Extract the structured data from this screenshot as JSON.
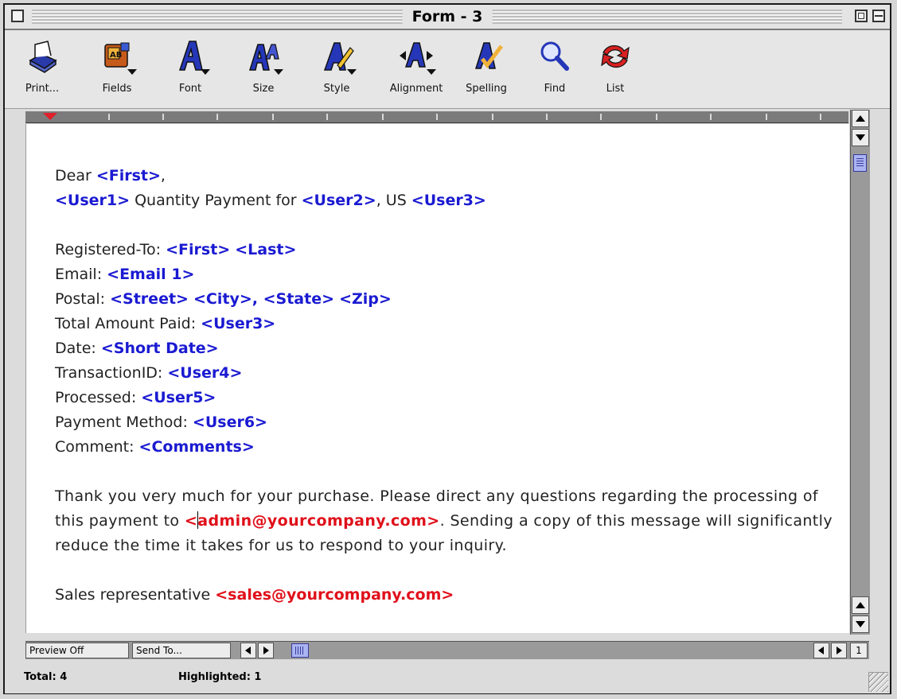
{
  "window": {
    "title": "Form - 3"
  },
  "toolbar": {
    "items": [
      {
        "label": "Print...",
        "icon": "printer-icon"
      },
      {
        "label": "Fields",
        "icon": "fields-icon"
      },
      {
        "label": "Font",
        "icon": "font-icon"
      },
      {
        "label": "Size",
        "icon": "size-icon"
      },
      {
        "label": "Style",
        "icon": "style-icon"
      },
      {
        "label": "Alignment",
        "icon": "alignment-icon"
      },
      {
        "label": "Spelling",
        "icon": "spelling-icon"
      },
      {
        "label": "Find",
        "icon": "magnifier-icon"
      },
      {
        "label": "List",
        "icon": "list-icon"
      }
    ]
  },
  "document": {
    "greeting_text": "Dear ",
    "greeting_field": "<First>",
    "greeting_comma": ",",
    "line2_field1": "<User1>",
    "line2_text1": " Quantity Payment for ",
    "line2_field2": "<User2>",
    "line2_text2": ", US ",
    "line2_field3": "<User3>",
    "registered_label": "Registered-To: ",
    "registered_first": "<First>",
    "registered_last": "<Last>",
    "email_label": "Email: ",
    "email_field": "<Email 1>",
    "postal_label": "Postal: ",
    "postal_street": "<Street>",
    "postal_city": "<City>",
    "postal_comma": ", ",
    "postal_state": "<State>",
    "postal_zip": "<Zip>",
    "total_label": "Total Amount Paid: ",
    "total_field": "<User3>",
    "date_label": "Date: ",
    "date_field": "<Short Date>",
    "transaction_label": "TransactionID: ",
    "transaction_field": "<User4>",
    "processed_label": "Processed: ",
    "processed_field": "<User5>",
    "payment_label": "Payment Method: ",
    "payment_field": "<User6>",
    "comment_label": "Comment: ",
    "comment_field": "<Comments>",
    "para_text1": "Thank you very much for your purchase. Please direct any questions regarding the processing of this payment to ",
    "para_email_lead": "<",
    "para_email_rest": "admin@yourcompany.com>",
    "para_text2": ". Sending a copy of this message will significantly reduce the time it takes for us to respond to your inquiry.",
    "sales_text": "Sales representative ",
    "sales_email": "<sales@yourcompany.com>"
  },
  "bottom_bar": {
    "preview_label": "Preview Off",
    "send_label": "Send To...",
    "page_number": "1"
  },
  "status": {
    "total": "Total: 4",
    "highlighted": "Highlighted: 1"
  },
  "colors": {
    "field_blue": "#1a1ad2",
    "field_red": "#e0101a"
  }
}
